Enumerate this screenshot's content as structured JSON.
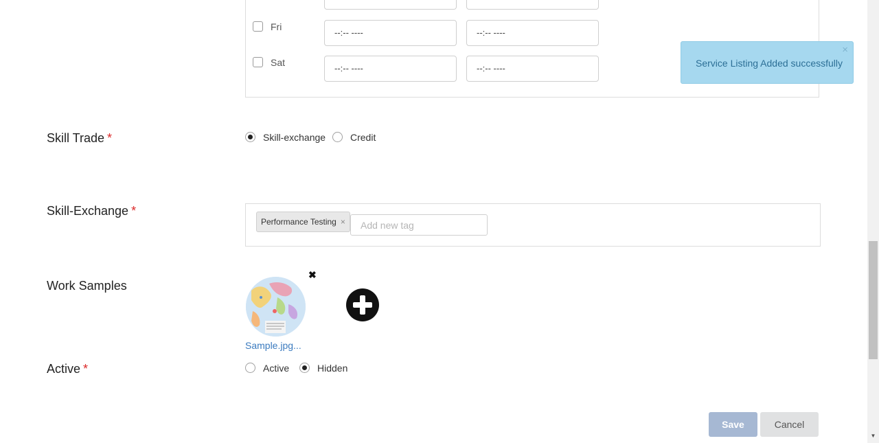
{
  "availability": {
    "time_placeholder": "--:-- ----",
    "days": [
      {
        "label": "Fri"
      },
      {
        "label": "Sat"
      }
    ]
  },
  "toast": {
    "message": "Service Listing Added successfully",
    "close_glyph": "×"
  },
  "skill_trade": {
    "label": "Skill Trade",
    "required_mark": "*",
    "options": [
      "Skill-exchange",
      "Credit"
    ],
    "selected": "Skill-exchange"
  },
  "skill_exchange": {
    "label": "Skill-Exchange",
    "required_mark": "*",
    "tags": [
      "Performance Testing"
    ],
    "tag_remove_glyph": "×",
    "new_tag_placeholder": "Add new tag"
  },
  "work_samples": {
    "label": "Work Samples",
    "filename": "Sample.jpg...",
    "remove_glyph": "✖"
  },
  "active": {
    "label": "Active",
    "required_mark": "*",
    "options": [
      "Active",
      "Hidden"
    ],
    "selected": "Hidden"
  },
  "actions": {
    "save_label": "Save",
    "cancel_label": "Cancel"
  },
  "colors": {
    "toast_bg": "#a6d8ef",
    "toast_text": "#2c6f96",
    "required": "#db2828",
    "link": "#3b7bbf",
    "save_bg": "#a6b8d3",
    "cancel_bg": "#e0e1e2"
  }
}
